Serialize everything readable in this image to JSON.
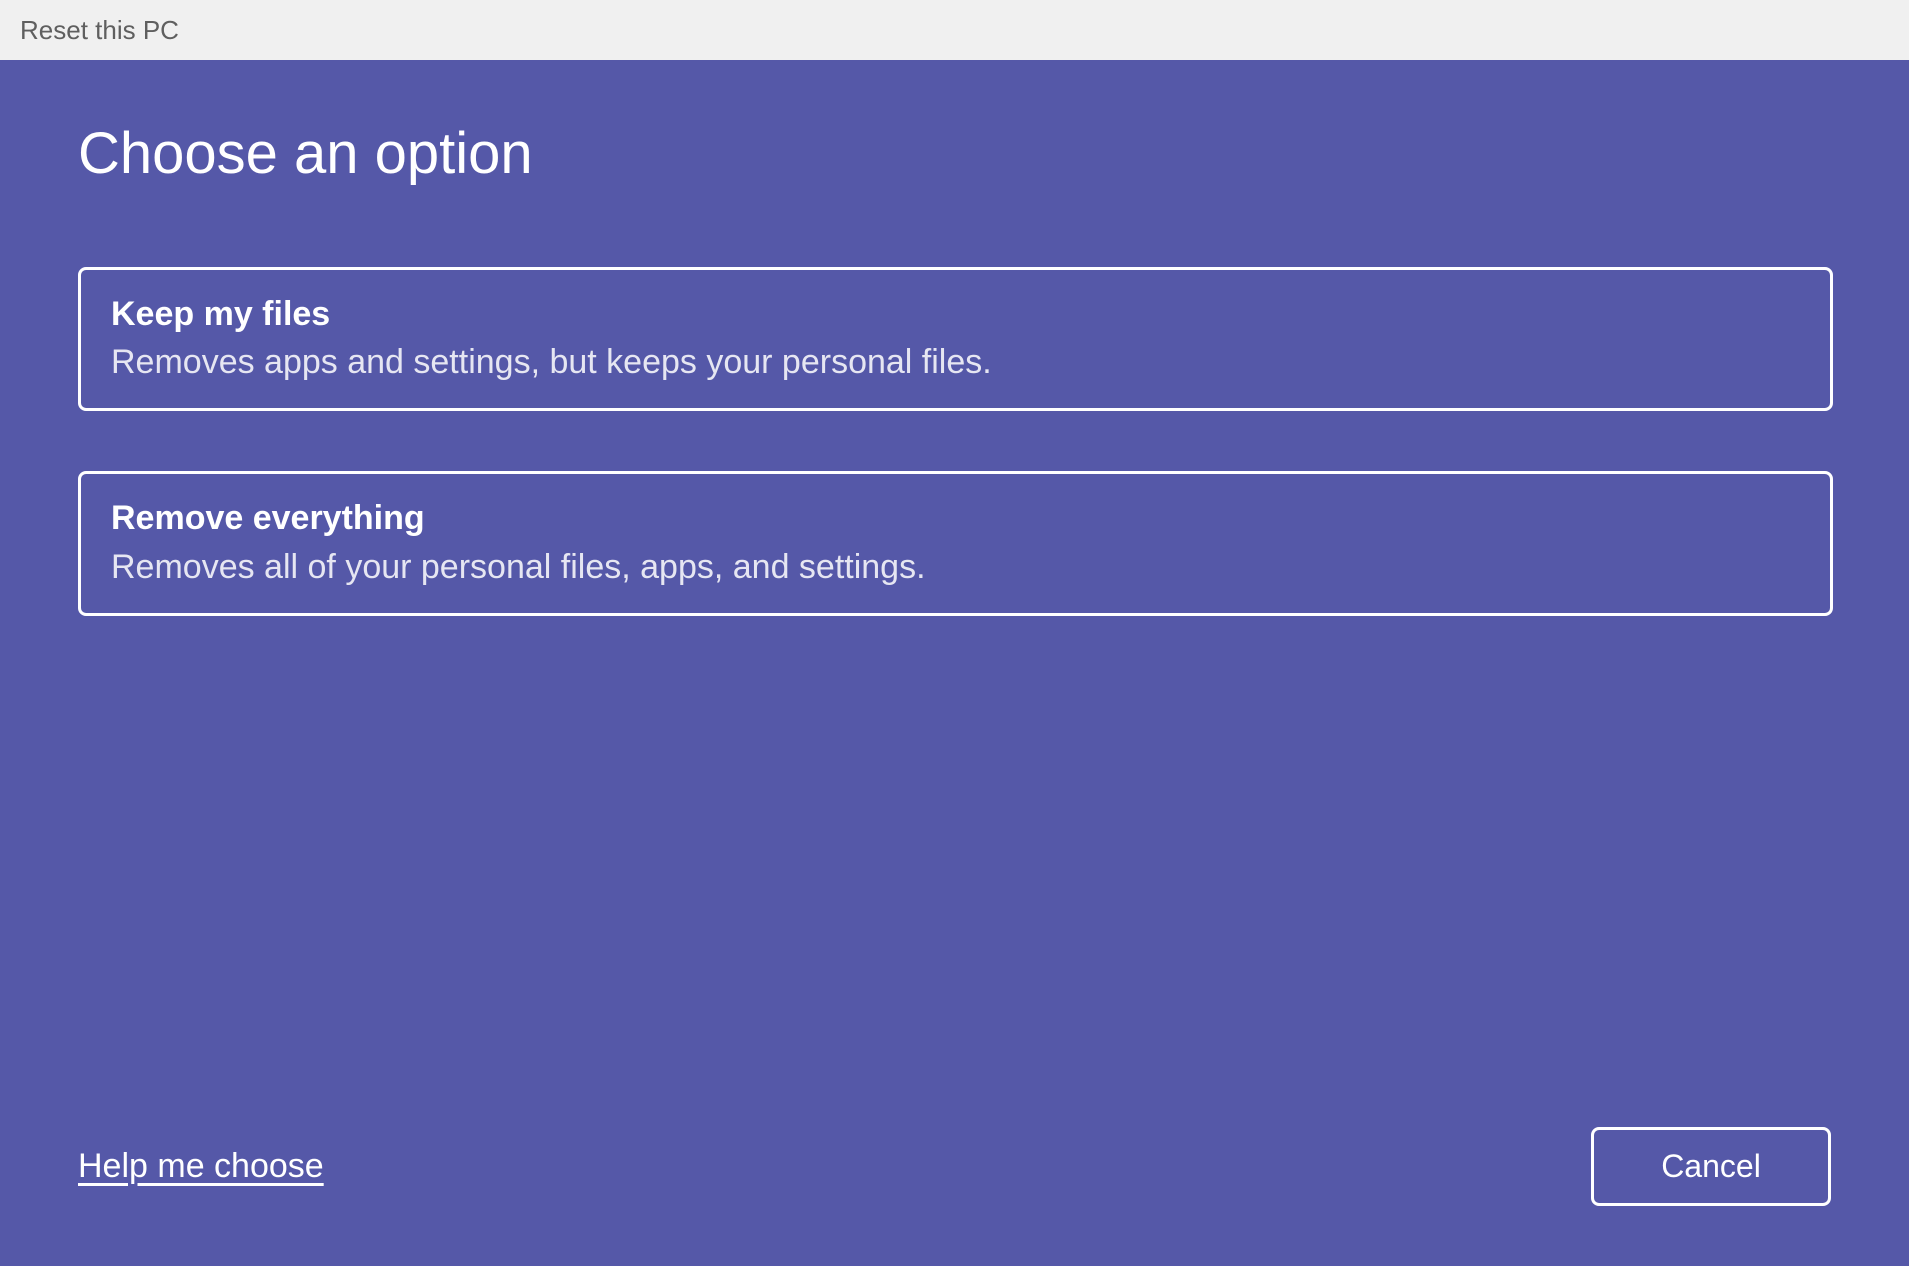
{
  "window": {
    "title": "Reset this PC"
  },
  "page": {
    "heading": "Choose an option"
  },
  "options": {
    "keep": {
      "title": "Keep my files",
      "description": "Removes apps and settings, but keeps your personal files."
    },
    "remove": {
      "title": "Remove everything",
      "description": "Removes all of your personal files, apps, and settings."
    }
  },
  "footer": {
    "help_link": "Help me choose",
    "cancel_label": "Cancel"
  },
  "colors": {
    "accent_background": "#5558a8",
    "titlebar_background": "#f0f0f0",
    "titlebar_text": "#5f5f5f",
    "foreground": "#ffffff"
  }
}
